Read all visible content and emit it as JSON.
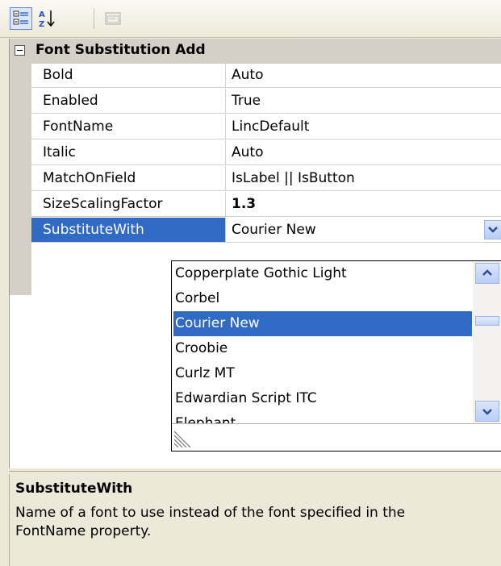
{
  "toolbar": {
    "categorized_icon": "categorized-icon",
    "alphabetical_icon": "alphabetical-icon",
    "property_pages_icon": "property-pages-icon"
  },
  "category": {
    "title": "Font Substitution Add"
  },
  "properties": [
    {
      "name": "Bold",
      "value": "Auto"
    },
    {
      "name": "Enabled",
      "value": "True"
    },
    {
      "name": "FontName",
      "value": "LincDefault"
    },
    {
      "name": "Italic",
      "value": "Auto"
    },
    {
      "name": "MatchOnField",
      "value": "IsLabel || IsButton"
    },
    {
      "name": "SizeScalingFactor",
      "value": "1.3"
    },
    {
      "name": "SubstituteWith",
      "value": "Courier New"
    }
  ],
  "dropdown": {
    "options": [
      "Copperplate Gothic Light",
      "Corbel",
      "Courier New",
      "Croobie",
      "Curlz MT",
      "Edwardian Script ITC",
      "Elephant"
    ],
    "selected": "Courier New"
  },
  "description": {
    "title": "SubstituteWith",
    "text": "Name of a font to use instead of the font specified in the FontName property."
  },
  "colors": {
    "selection": "#316ac5",
    "category_bg": "#d4d0c8",
    "panel_bg": "#ece9d8"
  }
}
